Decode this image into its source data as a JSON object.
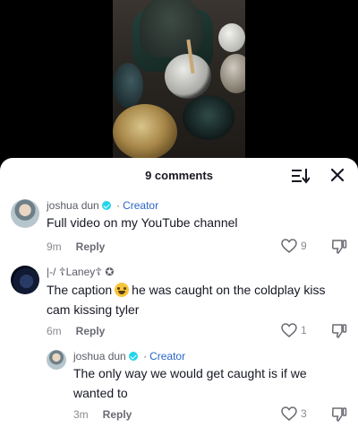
{
  "panel": {
    "title": "9 comments"
  },
  "comments": [
    {
      "author": "joshua dun",
      "creator_label": "Creator",
      "separator": "·",
      "text": "Full video on my YouTube channel",
      "time": "9m",
      "reply_label": "Reply",
      "likes": "9"
    },
    {
      "author": "|-/ ☦Laney☦ ✪",
      "text_before_emoji": "The caption",
      "emoji": "laughing-crying-emoji",
      "text_after_emoji": "he was caught on the coldplay kiss cam kissing tyler",
      "time": "6m",
      "reply_label": "Reply",
      "likes": "1"
    },
    {
      "author": "joshua dun",
      "creator_label": "Creator",
      "separator": "·",
      "text": "The only way we would get caught is if we wanted to",
      "time": "3m",
      "reply_label": "Reply",
      "likes": "3"
    }
  ],
  "colors": {
    "verified": "#20d5ec",
    "creator": "#2a66c8",
    "text": "#161823"
  }
}
